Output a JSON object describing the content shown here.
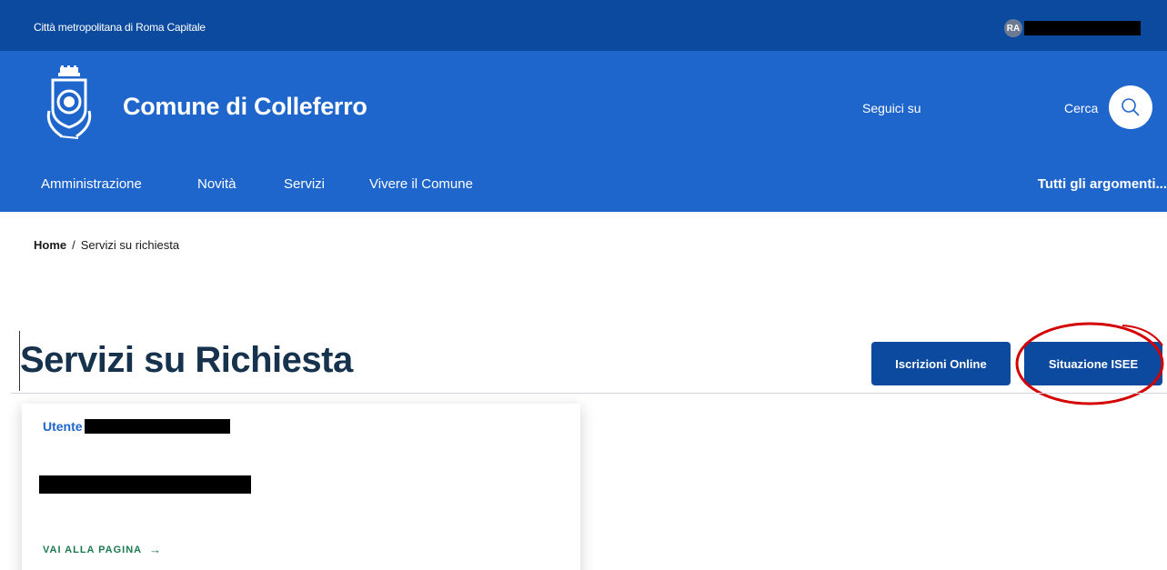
{
  "slim_header": {
    "region": "Città metropolitana di Roma Capitale",
    "user_initials": "RA"
  },
  "header": {
    "site_title": "Comune di Colleferro",
    "social_label": "Seguici su",
    "search_label": "Cerca",
    "search_icon": "search-icon",
    "logo_icon": "municipal-crest-icon"
  },
  "nav": {
    "items": [
      {
        "label": "Amministrazione"
      },
      {
        "label": "Novità"
      },
      {
        "label": "Servizi"
      },
      {
        "label": "Vivere il Comune"
      }
    ],
    "right_label": "Tutti gli argomenti..."
  },
  "breadcrumb": {
    "home": "Home",
    "separator": "/",
    "current": "Servizi su richiesta"
  },
  "page": {
    "title": "Servizi su Richiesta",
    "buttons": {
      "iscrizioni": "Iscrizioni Online",
      "isee": "Situazione ISEE"
    }
  },
  "card": {
    "title": "Utente",
    "link_label": "VAI ALLA PAGINA",
    "link_icon": "arrow-right-icon"
  },
  "colors": {
    "slim_header_bg": "#0b4a9e",
    "header_bg": "#1f66cc",
    "title_color": "#17324d",
    "link_green": "#1c7a4e",
    "annotation_red": "#d40000"
  }
}
